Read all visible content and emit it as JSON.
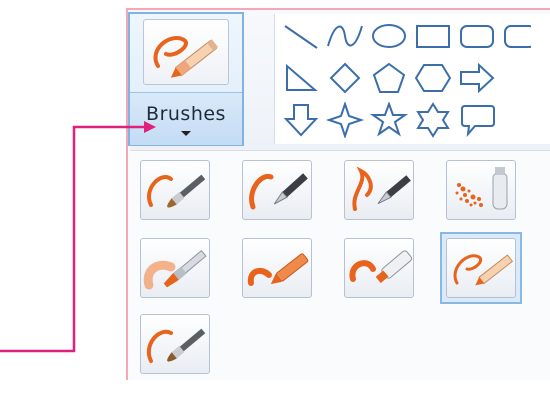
{
  "brushes_button": {
    "label": "Brushes",
    "icon": "crayon-brush-icon"
  },
  "shapes_gallery": {
    "rows": [
      [
        "line-shape-icon",
        "curve-shape-icon",
        "oval-shape-icon",
        "rectangle-shape-icon",
        "rounded-rectangle-shape-icon"
      ],
      [
        "right-triangle-shape-icon",
        "diamond-shape-icon",
        "pentagon-shape-icon",
        "hexagon-shape-icon",
        "right-arrow-shape-icon"
      ],
      [
        "down-arrow-shape-icon",
        "four-point-star-shape-icon",
        "five-point-star-shape-icon",
        "six-point-star-shape-icon",
        "callout-shape-icon"
      ]
    ]
  },
  "brush_types": [
    {
      "icon": "brush-icon",
      "selected": false
    },
    {
      "icon": "calligraphy-brush-1-icon",
      "selected": false
    },
    {
      "icon": "calligraphy-brush-2-icon",
      "selected": false
    },
    {
      "icon": "airbrush-icon",
      "selected": false
    },
    {
      "icon": "oil-brush-icon",
      "selected": false
    },
    {
      "icon": "crayon-icon",
      "selected": false
    },
    {
      "icon": "marker-icon",
      "selected": false
    },
    {
      "icon": "natural-pencil-icon",
      "selected": true
    },
    {
      "icon": "watercolor-brush-icon",
      "selected": false
    }
  ],
  "colors": {
    "accent_orange": "#e8631c",
    "selection_blue": "#8ab8e4",
    "callout_magenta": "#e0207a",
    "panel_border_pink": "#f4a7b6"
  }
}
